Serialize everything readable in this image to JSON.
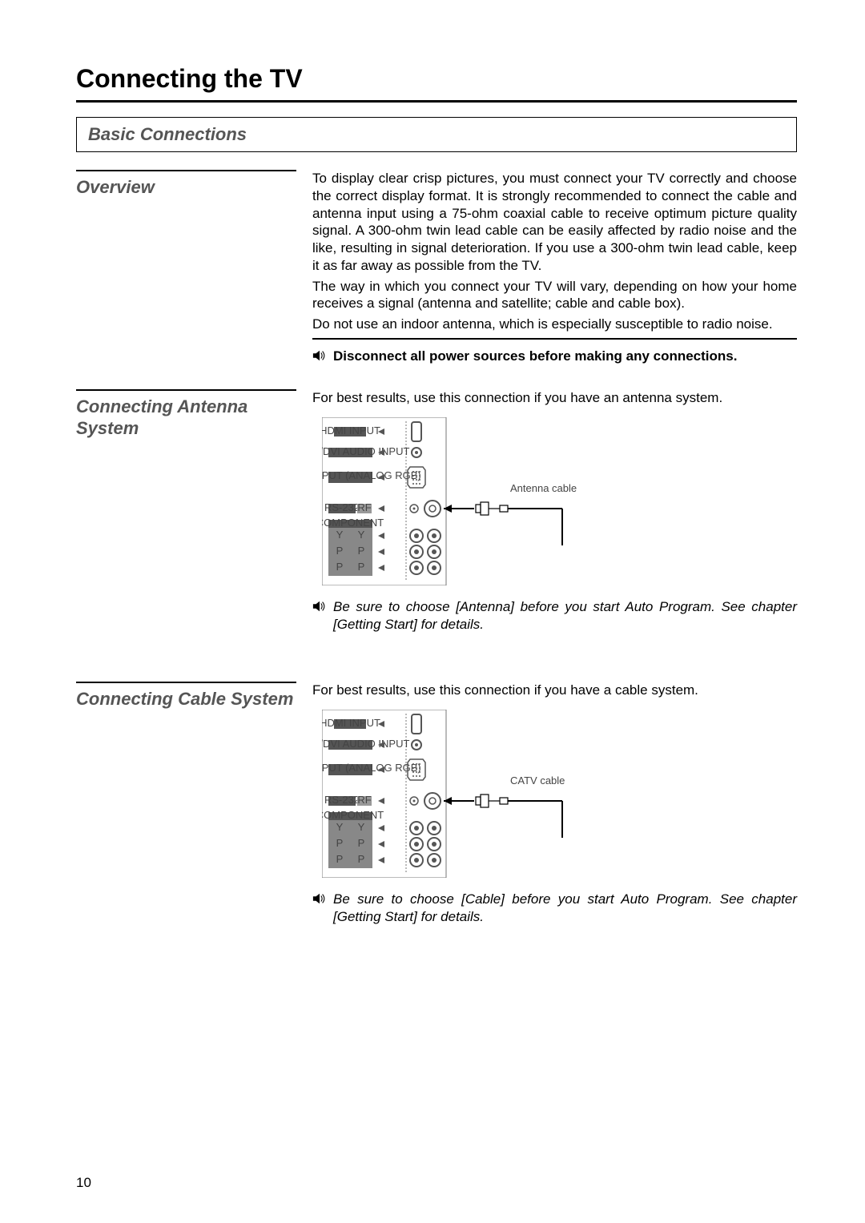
{
  "pageTitle": "Connecting the TV",
  "basicConnections": "Basic Connections",
  "overview": {
    "heading": "Overview",
    "p1": "To display clear crisp pictures, you must connect your TV correctly and choose the correct display format. It is strongly recommended to connect the cable and antenna input using a 75-ohm coaxial cable to receive optimum picture quality signal. A 300-ohm twin lead cable can be easily affected by radio noise and the like, resulting in signal deterioration. If you use a 300-ohm twin lead cable, keep it as far away as possible from the TV.",
    "p2": "The way in which you connect your TV will vary, depending on how your home receives a signal (antenna and satellite; cable and cable box).",
    "p3": "Do not use an indoor antenna, which is especially susceptible to radio noise.",
    "warn": "Disconnect all power sources before making any connections."
  },
  "antenna": {
    "heading": "Connecting Antenna System",
    "intro": "For best results, use this connection if you have an antenna system.",
    "diagramLabel": "Antenna cable",
    "note": "Be sure to choose [Antenna] before you start Auto Program. See chapter [Getting Start] for details."
  },
  "cable": {
    "heading": "Connecting Cable System",
    "intro": "For best results, use this connection if you have a cable system.",
    "diagramLabel": "CATV cable",
    "note": "Be sure to choose [Cable] before you start Auto Program. See chapter [Getting Start] for details."
  },
  "panel": {
    "hdmi": "HDMI INPUT",
    "dsubAudio": "D-Sub/DVI AUDIO INPUT",
    "dsubInput": "D-Sub INPUT (ANALOG RGB)",
    "rs232": "RS-232",
    "rf": "RF",
    "component": "COMPONENT",
    "y": "Y",
    "pb": "P",
    "pr": "P"
  },
  "pageNumber": "10"
}
